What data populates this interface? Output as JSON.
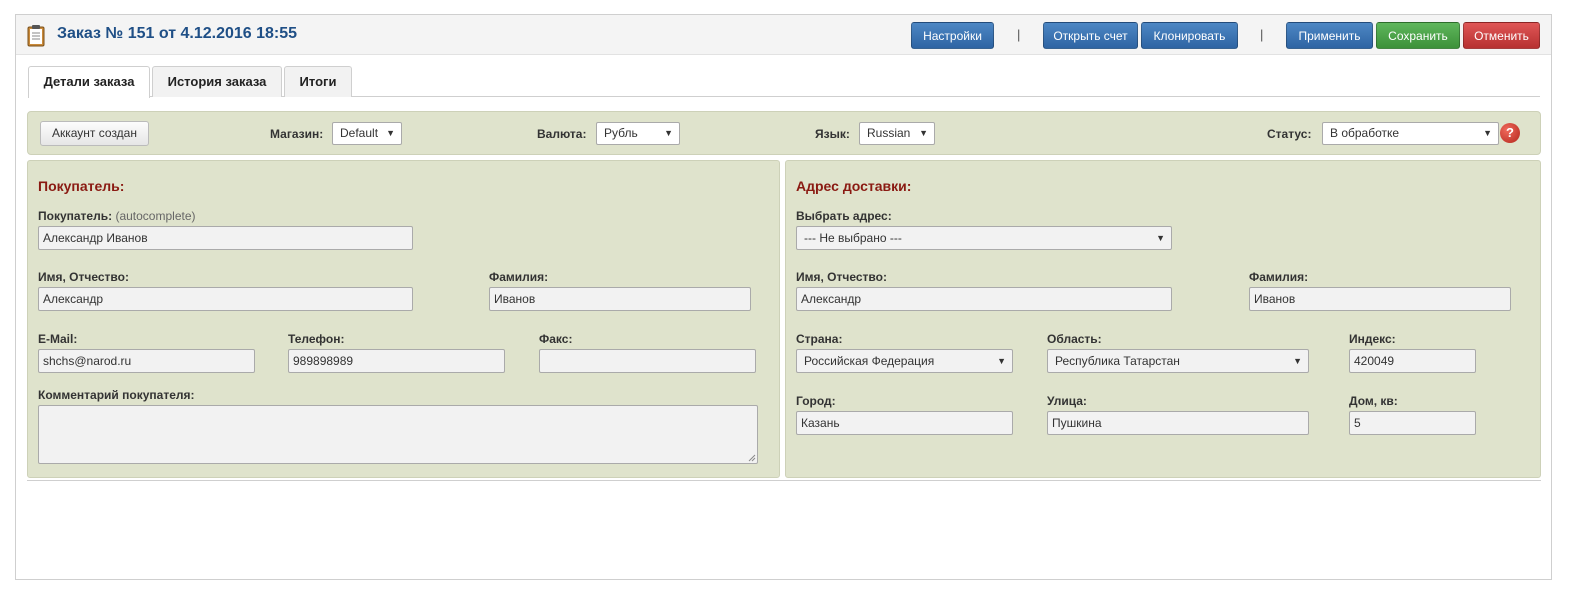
{
  "header": {
    "title": "Заказ № 151 от 4.12.2016 18:55",
    "buttons": {
      "settings": "Настройки",
      "open_invoice": "Открыть счет",
      "clone": "Клонировать",
      "apply": "Применить",
      "save": "Сохранить",
      "cancel": "Отменить"
    },
    "separator": "|"
  },
  "tabs": [
    {
      "label": "Детали заказа",
      "active": true
    },
    {
      "label": "История заказа",
      "active": false
    },
    {
      "label": "Итоги",
      "active": false
    }
  ],
  "filters": {
    "account_button": "Аккаунт создан",
    "shop": {
      "label": "Магазин:",
      "value": "Default"
    },
    "currency": {
      "label": "Валюта:",
      "value": "Рубль"
    },
    "language": {
      "label": "Язык:",
      "value": "Russian"
    },
    "status": {
      "label": "Статус:",
      "value": "В обработке"
    },
    "help_icon": "?"
  },
  "buyer": {
    "section_title": "Покупатель:",
    "customer_label": "Покупатель:",
    "customer_hint": "(autocomplete)",
    "customer_value": "Александр Иванов",
    "first_name_label": "Имя, Отчество:",
    "first_name_value": "Александр",
    "last_name_label": "Фамилия:",
    "last_name_value": "Иванов",
    "email_label": "E-Mail:",
    "email_value": "shchs@narod.ru",
    "phone_label": "Телефон:",
    "phone_value": "989898989",
    "fax_label": "Факс:",
    "fax_value": "",
    "comment_label": "Комментарий покупателя:",
    "comment_value": ""
  },
  "shipping": {
    "section_title": "Адрес доставки:",
    "select_address_label": "Выбрать адрес:",
    "select_address_value": "--- Не выбрано ---",
    "first_name_label": "Имя, Отчество:",
    "first_name_value": "Александр",
    "last_name_label": "Фамилия:",
    "last_name_value": "Иванов",
    "country_label": "Страна:",
    "country_value": "Российская Федерация",
    "region_label": "Область:",
    "region_value": "Республика Татарстан",
    "zip_label": "Индекс:",
    "zip_value": "420049",
    "city_label": "Город:",
    "city_value": "Казань",
    "street_label": "Улица:",
    "street_value": "Пушкина",
    "house_label": "Дом, кв:",
    "house_value": "5"
  },
  "colors": {
    "title": "#1f4f86",
    "section_title": "#8a1a12",
    "panel_bg": "#dfe3cc",
    "btn_blue": "#2e64a3",
    "btn_green": "#3c9139",
    "btn_red": "#b73131"
  }
}
